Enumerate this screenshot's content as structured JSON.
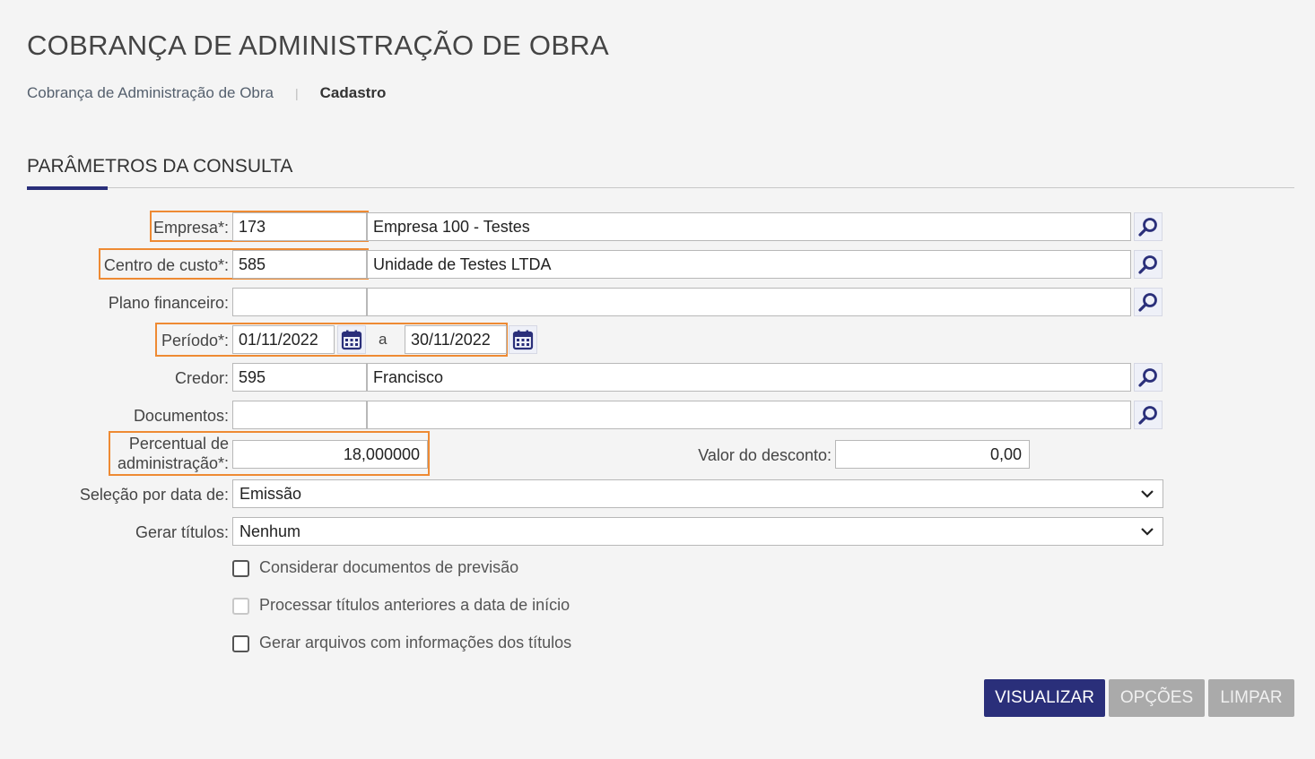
{
  "page_title": "COBRANÇA DE ADMINISTRAÇÃO DE OBRA",
  "breadcrumb": {
    "link": "Cobrança de Administração de Obra",
    "separator": "|",
    "current": "Cadastro"
  },
  "section_title": "PARÂMETROS DA CONSULTA",
  "form": {
    "empresa": {
      "label": "Empresa*:",
      "code": "173",
      "name": "Empresa 100 - Testes"
    },
    "centro_custo": {
      "label": "Centro de custo*:",
      "code": "585",
      "name": "Unidade de Testes LTDA"
    },
    "plano_financeiro": {
      "label": "Plano financeiro:",
      "code": "",
      "name": ""
    },
    "periodo": {
      "label": "Período*:",
      "start": "01/11/2022",
      "separator": "a",
      "end": "30/11/2022"
    },
    "credor": {
      "label": "Credor:",
      "code": "595",
      "name": "Francisco"
    },
    "documentos": {
      "label": "Documentos:",
      "code": "",
      "name": ""
    },
    "percentual": {
      "label_line1": "Percentual de",
      "label_line2": "administração*:",
      "value": "18,000000"
    },
    "valor_desconto": {
      "label": "Valor do desconto:",
      "value": "0,00"
    },
    "selecao_data": {
      "label": "Seleção por data de:",
      "value": "Emissão"
    },
    "gerar_titulos": {
      "label": "Gerar títulos:",
      "value": "Nenhum"
    },
    "checkboxes": [
      {
        "label": "Considerar documentos de previsão",
        "checked": false,
        "disabled": false
      },
      {
        "label": "Processar títulos anteriores a data de início",
        "checked": false,
        "disabled": true
      },
      {
        "label": "Gerar arquivos com informações dos títulos",
        "checked": false,
        "disabled": false
      }
    ]
  },
  "buttons": {
    "visualizar": "VISUALIZAR",
    "opcoes": "OPÇÕES",
    "limpar": "LIMPAR"
  },
  "colors": {
    "primary": "#2a2f7a",
    "highlight": "#ee8a33",
    "disabled_button": "#aaaaaa",
    "background": "#f4f4f4"
  },
  "icons": {
    "search": "search-icon",
    "calendar": "calendar-icon",
    "dropdown": "chevron-down-icon"
  }
}
